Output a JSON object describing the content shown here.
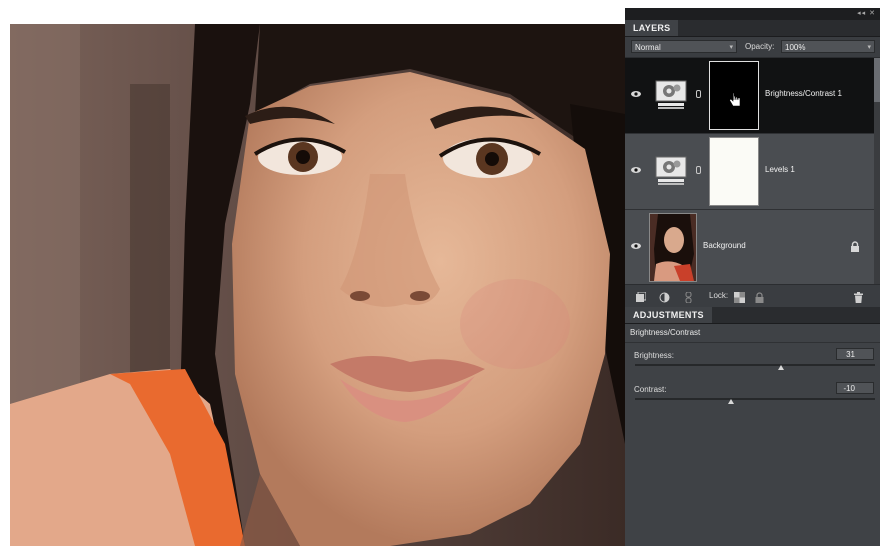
{
  "layers_panel": {
    "title": "LAYERS",
    "blend_mode": "Normal",
    "opacity_label": "Opacity:",
    "opacity_value": "100%",
    "layers": [
      {
        "name": "Brightness/Contrast 1",
        "type": "adjustment",
        "selected": true,
        "mask_color": "#000000"
      },
      {
        "name": "Levels 1",
        "type": "adjustment",
        "selected": false,
        "mask_color": "#fbfbf6"
      },
      {
        "name": "Background",
        "type": "image",
        "selected": false,
        "locked": true
      }
    ],
    "lock_label": "Lock:"
  },
  "adjustments_panel": {
    "title": "ADJUSTMENTS",
    "adjustment_name": "Brightness/Contrast",
    "sliders": [
      {
        "label": "Brightness:",
        "value": "31",
        "fraction": 0.61
      },
      {
        "label": "Contrast:",
        "value": "-10",
        "fraction": 0.4
      }
    ]
  },
  "colors": {
    "panel_bg": "#3f4246",
    "selected_row": "#111213",
    "tab_bar": "#2a2c2f"
  }
}
